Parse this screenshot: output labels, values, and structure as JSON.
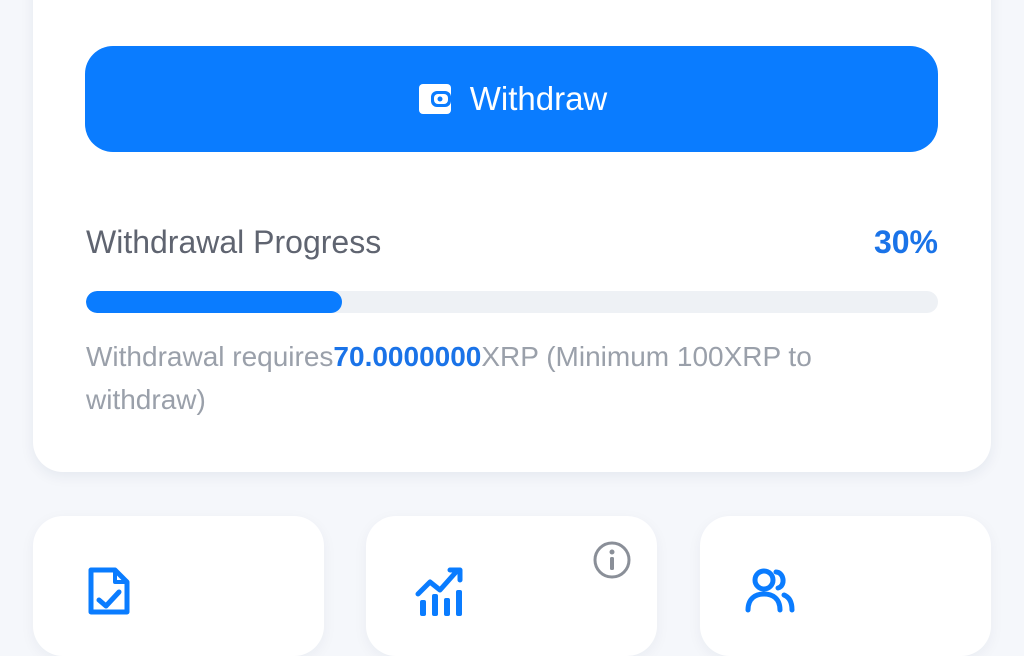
{
  "withdraw_button": {
    "label": "Withdraw",
    "icon": "wallet-icon"
  },
  "progress": {
    "label": "Withdrawal Progress",
    "percent_text": "30%",
    "fraction": 0.3,
    "requirement_prefix": "Withdrawal requires",
    "requirement_amount": "70.0000000",
    "requirement_suffix": "XRP (Minimum 100XRP to withdraw)"
  },
  "tiles": [
    {
      "icon": "document-check-icon"
    },
    {
      "icon": "chart-growth-icon",
      "badge_icon": "info-icon"
    },
    {
      "icon": "users-icon"
    }
  ],
  "colors": {
    "accent": "#0a7cff",
    "accent_text": "#1a73e8",
    "muted_text": "#9aa0aa",
    "label_text": "#5f6470",
    "track": "#eef1f5",
    "background": "#f5f7fb"
  }
}
